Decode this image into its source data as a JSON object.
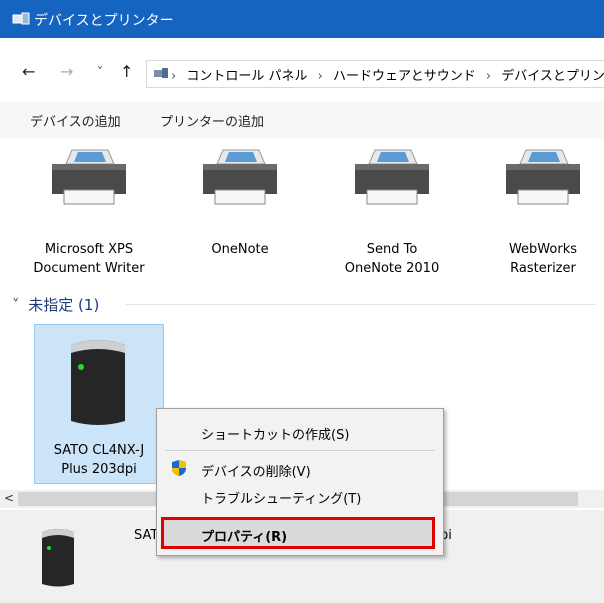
{
  "window": {
    "title": "デバイスとプリンター"
  },
  "nav": {
    "back": "←",
    "forward": "→",
    "recent": "˅",
    "up": "↑"
  },
  "breadcrumb": [
    "コントロール パネル",
    "ハードウェアとサウンド",
    "デバイスとプリンター"
  ],
  "toolbar": {
    "add_device": "デバイスの追加",
    "add_printer": "プリンターの追加"
  },
  "printers": [
    {
      "line1": "Microsoft XPS",
      "line2": "Document Writer"
    },
    {
      "line1": "OneNote",
      "line2": ""
    },
    {
      "line1": "Send To",
      "line2": "OneNote 2010"
    },
    {
      "line1": "WebWorks",
      "line2": "Rasterizer"
    }
  ],
  "group": {
    "label": "未指定 (1)",
    "chevron": "˅"
  },
  "unspecified_device": {
    "line1": "SATO CL4NX-J",
    "line2": "Plus 203dpi"
  },
  "details": {
    "name_visible_left": "SAT",
    "name_visible_right": "pi"
  },
  "context_menu": {
    "items": [
      {
        "label": "ショートカットの作成(S)"
      },
      {
        "label": "デバイスの削除(V)",
        "icon": "uac-shield-icon"
      },
      {
        "label": "トラブルシューティング(T)"
      },
      {
        "label": "プロパティ(R)",
        "highlighted": true
      }
    ]
  },
  "scrollbar": {
    "left_arrow": "<"
  },
  "colors": {
    "titlebar": "#1565c0",
    "highlight_border": "#e10000",
    "selection": "#cce4f7"
  }
}
